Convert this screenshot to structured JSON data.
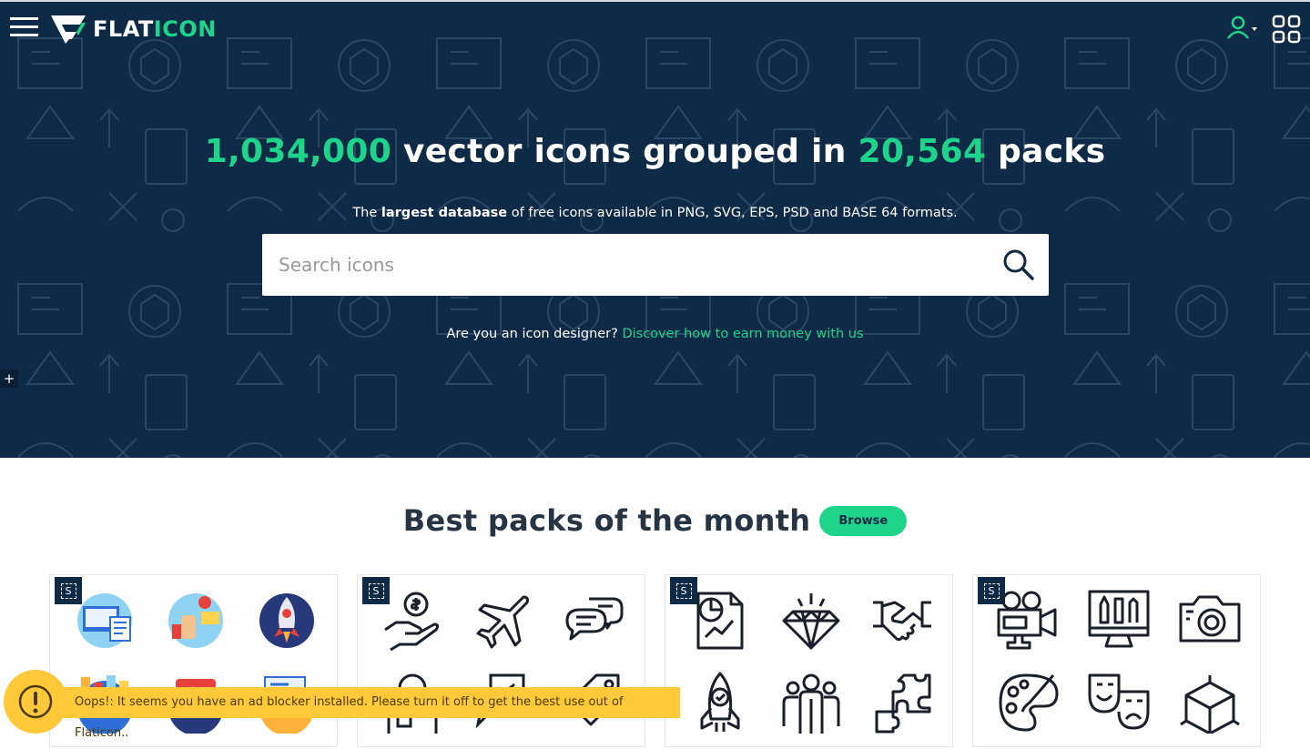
{
  "header": {
    "logo_text_a": "FLAT",
    "logo_text_b": "ICON",
    "menu_icon": "hamburger-icon",
    "user_icon": "user-icon",
    "apps_icon": "grid-icon"
  },
  "hero": {
    "headline_count": "1,034,000",
    "headline_mid": " vector icons grouped in ",
    "headline_packs": "20,564",
    "headline_end": " packs",
    "sub_pre": "The ",
    "sub_bold": "largest database",
    "sub_post": " of free icons available in PNG, SVG, EPS, PSD and BASE 64 formats.",
    "search_placeholder": "Search icons",
    "designer_text": "Are you an icon designer? ",
    "designer_link": "Discover how to earn money with us",
    "plus_label": "+"
  },
  "section": {
    "title": "Best packs of the month",
    "browse_label": "Browse"
  },
  "packs": [
    {
      "badge": "S",
      "icons": [
        "web-design-icon",
        "social-media-icon",
        "rocket-icon",
        "analytics-icon",
        "video-icon",
        "blog-icon"
      ]
    },
    {
      "badge": "S",
      "icons": [
        "money-hand-icon",
        "airplane-icon",
        "chat-icon",
        "user-icon",
        "message-icon",
        "tag-icon"
      ]
    },
    {
      "badge": "S",
      "icons": [
        "report-icon",
        "diamond-icon",
        "handshake-icon",
        "rocket-icon",
        "team-icon",
        "puzzle-icon"
      ]
    },
    {
      "badge": "S",
      "icons": [
        "video-camera-icon",
        "design-monitor-icon",
        "camera-icon",
        "palette-icon",
        "theater-masks-icon",
        "cube-icon"
      ]
    }
  ],
  "adblock": {
    "message": "Oops!: It seems you have an ad blocker installed. Please turn it off to get the best use out of Flaticon.."
  },
  "colors": {
    "hero_bg": "#0e2a47",
    "accent": "#1ed38a",
    "warning": "#ffc93a"
  }
}
